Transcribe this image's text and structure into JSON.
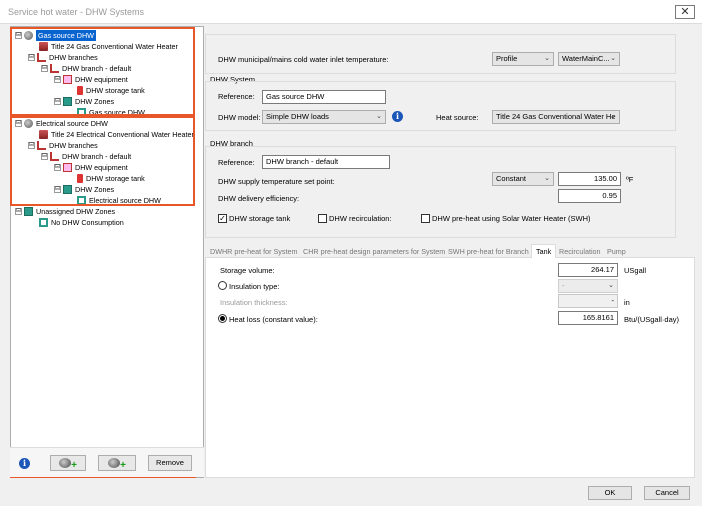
{
  "window": {
    "title": "Service hot water - DHW Systems",
    "close_label": "✕"
  },
  "tree": {
    "gas": {
      "root": "Gas source DHW",
      "heater": "Title 24 Gas Conventional Water Heater",
      "branches": "DHW branches",
      "branch": "DHW branch - default",
      "equipment": "DHW equipment",
      "tank": "DHW storage tank",
      "zones": "DHW Zones",
      "zone": "Gas source DHW"
    },
    "electric": {
      "root": "Electrical source DHW",
      "heater": "Title 24 Electrical Conventional Water Heater",
      "branches": "DHW branches",
      "branch": "DHW branch - default",
      "equipment": "DHW equipment",
      "tank": "DHW storage tank",
      "zones": "DHW Zones",
      "zone": "Electrical source DHW"
    },
    "unassigned": {
      "root": "Unassigned DHW Zones",
      "child": "No DHW Consumption"
    },
    "expand_sign": "⊟",
    "remove_label": "Remove"
  },
  "inlet": {
    "label": "DHW municipal/mains cold water inlet temperature:",
    "mode": "Profile",
    "profile": "WaterMainC..."
  },
  "system": {
    "group_title": "DHW System",
    "reference_label": "Reference:",
    "reference_value": "Gas source DHW",
    "model_label": "DHW model:",
    "model_value": "Simple DHW loads",
    "heat_source_label": "Heat source:",
    "heat_source_value": "Title 24 Gas Conventional Water He"
  },
  "branch": {
    "group_title": "DHW branch",
    "reference_label": "Reference:",
    "reference_value": "DHW branch - default",
    "supply_label": "DHW supply temperature set point:",
    "supply_mode": "Constant",
    "supply_value": "135.00",
    "supply_unit": "ºF",
    "efficiency_label": "DHW delivery efficiency:",
    "efficiency_value": "0.95",
    "storage_tank_label": "DHW storage tank",
    "storage_tank_checked": "✓",
    "recirculation_label": "DHW recirculation:",
    "preheat_label": "DHW pre-heat using Solar Water Heater (SWH)"
  },
  "tabs": [
    "DWHR pre-heat for System",
    "CHR pre-heat design parameters for System",
    "SWH pre-heat for Branch",
    "Tank",
    "Recirculation",
    "Pump"
  ],
  "tank": {
    "storage_label": "Storage volume:",
    "storage_value": "264.17",
    "storage_unit": "USgall",
    "insulation_type_label": "Insulation type:",
    "insulation_type_value": "-",
    "insulation_thickness_label": "Insulation thickness:",
    "insulation_thickness_value": "-",
    "insulation_thickness_unit": "in",
    "heat_loss_label": "Heat loss (constant value):",
    "heat_loss_value": "165.8161",
    "heat_loss_unit": "Btu/(USgall·day)"
  },
  "footer": {
    "ok": "OK",
    "cancel": "Cancel"
  },
  "colors": {
    "highlight": "#e8572a",
    "selection": "#0a64d0",
    "info": "#1b57b8"
  }
}
